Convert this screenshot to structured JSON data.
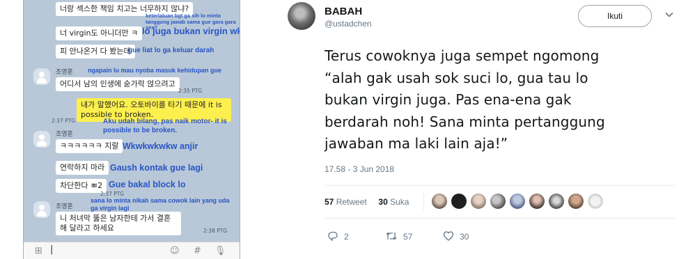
{
  "chat": {
    "messages": [
      {
        "text": "너랑 섹스한 책임 치고는 너무하지 않냐?",
        "translation": "keterlaluan bgt ga sih lo minta tanggung jawab sama gue gara gara sex?"
      },
      {
        "text": "너 virgin도 아니더만 ㅋ",
        "translation": "lo juga bukan virgin wk"
      },
      {
        "text": "피 안나온거 다 봤는데",
        "translation": "gue liat lo ga keluar darah"
      },
      {
        "sender": "조영훈",
        "text": "어디서 남의 인생에 숟가락 얹으려고",
        "translation": "ngapain lu mau nyoba masuk kehidupan gue",
        "time": "2:35 PTG"
      },
      {
        "text": "내가 말했어요. 오토바이를 타기 때문에 it is possible to broken.",
        "translation": "Aku udah bilang, pas naik motor- it is possible to be broken.",
        "time": "2:37 PTG"
      },
      {
        "sender": "조영훈",
        "text": "ㅋㅋㅋㅋㅋㅋ 지랄",
        "translation": "Wkwkwkwkw anjir"
      },
      {
        "text": "연락하지 마라",
        "translation": "Gaush kontak gue lagi"
      },
      {
        "text": "차단한다 ㅃ2",
        "translation": "Gue bakal block lo",
        "time": "2:37 PTG"
      },
      {
        "sender": "조영훈",
        "text": "니 처녀막 뚫은 남자한테 가서 결혼해 달라고 하세요",
        "translation": "sana lo minta nikah sama cowok lain yang uda ga virgin lagi",
        "time": "2:38 PTG"
      }
    ],
    "input_icons": [
      "plus-icon",
      "emoji-icon",
      "hash-icon",
      "mic-icon"
    ]
  },
  "tweet": {
    "display_name": "BABAH",
    "handle": "@ustadchen",
    "follow_label": "Ikuti",
    "text_lines": [
      "Terus cowoknya juga sempet ngomong",
      "“alah gak usah sok suci lo, gua tau lo",
      "bukan virgin juga. Pas ena-ena gak",
      "berdarah noh! Sana minta pertanggung",
      "jawaban ma laki lain aja!”"
    ],
    "timestamp": "17.58 - 3 Jun 2018",
    "retweet_count": "57",
    "retweet_label": "Retweet",
    "like_count": "30",
    "like_label": "Suka",
    "actions": {
      "reply": "2",
      "retweet": "57",
      "like": "30"
    },
    "colors": {
      "text": "#14171a",
      "muted": "#657786",
      "translation": "#2a55c5",
      "highlight": "#fdf04e"
    }
  }
}
